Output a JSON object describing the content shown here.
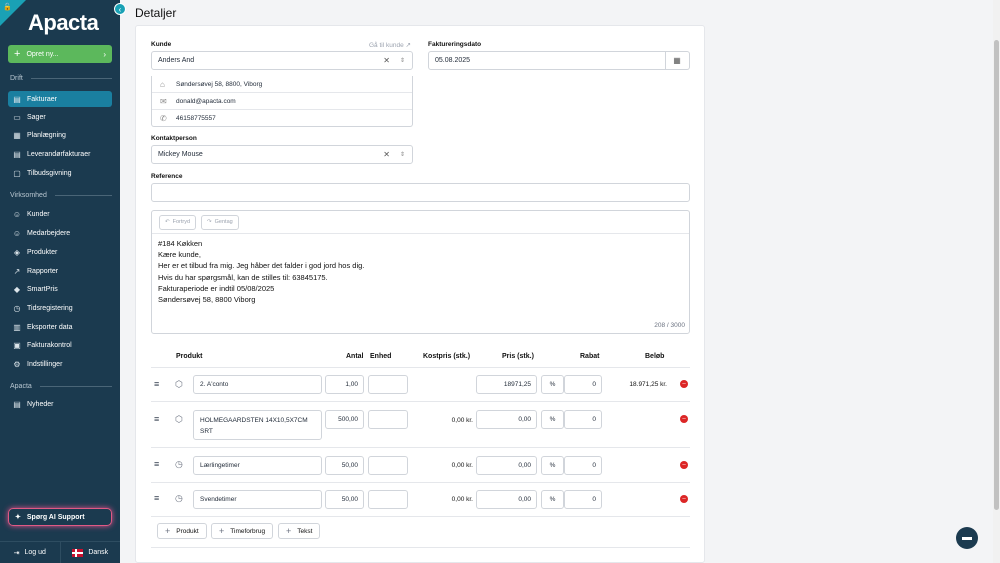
{
  "sidebar": {
    "logo": "Apacta",
    "opret_label": "Opret ny...",
    "sections": {
      "drift": "Drift",
      "virksomhed": "Virksomhed",
      "apacta": "Apacta"
    },
    "items": [
      {
        "label": "Fakturaer",
        "icon": "invoice-icon"
      },
      {
        "label": "Sager",
        "icon": "folder-icon"
      },
      {
        "label": "Planlægning",
        "icon": "calendar-icon"
      },
      {
        "label": "Leverandørfakturaer",
        "icon": "supplier-invoice-icon"
      },
      {
        "label": "Tilbudsgivning",
        "icon": "quote-icon"
      },
      {
        "label": "Kunder",
        "icon": "customers-icon"
      },
      {
        "label": "Medarbejdere",
        "icon": "employees-icon"
      },
      {
        "label": "Produkter",
        "icon": "box-icon"
      },
      {
        "label": "Rapporter",
        "icon": "chart-icon"
      },
      {
        "label": "SmartPris",
        "icon": "tag-icon"
      },
      {
        "label": "Tidsregistering",
        "icon": "clock-icon"
      },
      {
        "label": "Eksporter data",
        "icon": "export-icon"
      },
      {
        "label": "Fakturakontrol",
        "icon": "check-icon"
      },
      {
        "label": "Indstillinger",
        "icon": "gear-icon"
      },
      {
        "label": "Nyheder",
        "icon": "news-icon"
      }
    ],
    "ai_support": "Spørg AI Support",
    "logout": "Log ud",
    "language": "Dansk"
  },
  "page": {
    "title": "Detaljer"
  },
  "form": {
    "kunde_label": "Kunde",
    "gaa_til_kunde": "Gå til kunde",
    "kunde_value": "Anders And",
    "address": "Søndersøvej 58, 8800, Viborg",
    "email": "donald@apacta.com",
    "phone": "46158775557",
    "faktureringsdato_label": "Faktureringsdato",
    "faktureringsdato_value": "05.08.2025",
    "kontaktperson_label": "Kontaktperson",
    "kontaktperson_value": "Mickey Mouse",
    "reference_label": "Reference",
    "reference_value": ""
  },
  "editor": {
    "undo": "Fortryd",
    "redo": "Gentag",
    "lines": [
      "#184 Køkken",
      "Kære kunde,",
      "Her er et tilbud fra mig. Jeg håber det falder i god jord hos dig.",
      "Hvis du har spørgsmål, kan de stilles til: 63845175.",
      "Fakturaperiode er indtil 05/08/2025",
      "Søndersøvej 58, 8800 Viborg"
    ],
    "counter": "208 / 3000"
  },
  "table": {
    "headers": {
      "produkt": "Produkt",
      "antal": "Antal",
      "enhed": "Enhed",
      "kostpris": "Kostpris (stk.)",
      "pris": "Pris (stk.)",
      "rabat": "Rabat",
      "beloeb": "Beløb"
    },
    "rows": [
      {
        "type_icon": "box-icon",
        "name": "2. A'conto",
        "antal": "1,00",
        "enhed": "",
        "kostpris": "",
        "pris": "18971,25",
        "rabat_type": "%",
        "rabat": "0",
        "beloeb": "18.971,25 kr."
      },
      {
        "type_icon": "box-icon",
        "name": "HOLMEGAARDSTEN 14X10,5X7CM SRT",
        "antal": "500,00",
        "enhed": "",
        "kostpris": "0,00 kr.",
        "pris": "0,00",
        "rabat_type": "%",
        "rabat": "0",
        "beloeb": ""
      },
      {
        "type_icon": "clock-icon",
        "name": "Lærlingetimer",
        "antal": "50,00",
        "enhed": "",
        "kostpris": "0,00 kr.",
        "pris": "0,00",
        "rabat_type": "%",
        "rabat": "0",
        "beloeb": ""
      },
      {
        "type_icon": "clock-icon",
        "name": "Svendetimer",
        "antal": "50,00",
        "enhed": "",
        "kostpris": "0,00 kr.",
        "pris": "0,00",
        "rabat_type": "%",
        "rabat": "0",
        "beloeb": ""
      }
    ],
    "add_buttons": {
      "produkt": "Produkt",
      "timeforbrug": "Timeforbrug",
      "tekst": "Tekst"
    }
  },
  "colors": {
    "sidebar": "#1b3a4f",
    "active": "#1a7fa0",
    "green": "#5cb85c",
    "delete": "#dc2626"
  }
}
